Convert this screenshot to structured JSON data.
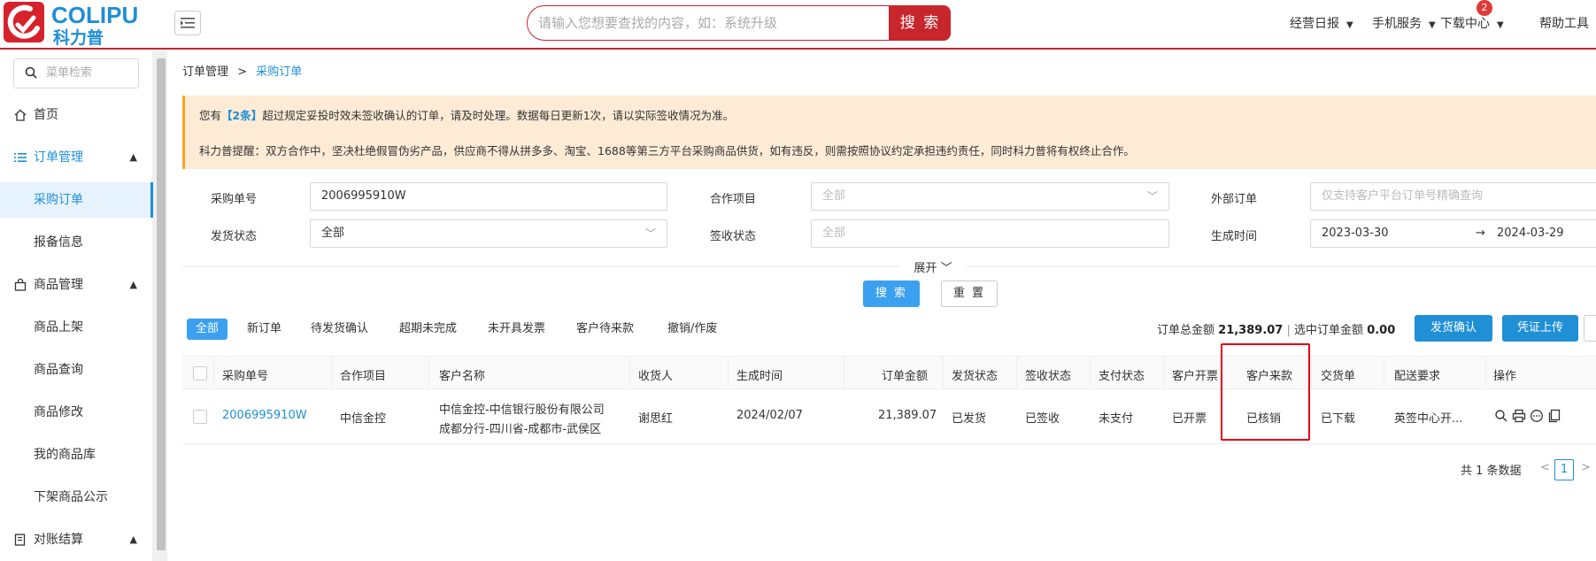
{
  "header": {
    "logo_en": "COLIPU",
    "logo_cn": "科力普",
    "search_placeholder": "请输入您想要查找的内容，如：系统升级",
    "search_button": "搜 索",
    "nav": [
      {
        "label": "经营日报"
      },
      {
        "label": "手机服务"
      },
      {
        "label": "下载中心"
      },
      {
        "label": "帮助工具"
      }
    ],
    "download_badge": "2"
  },
  "sidebar": {
    "search_placeholder": "菜单检索",
    "home": "首页",
    "order_mgmt": "订单管理",
    "purchase_order": "采购订单",
    "report_info": "报备信息",
    "product_mgmt": "商品管理",
    "product_list": "商品上架",
    "product_query": "商品查询",
    "product_edit": "商品修改",
    "my_products": "我的商品库",
    "delist_notice": "下架商品公示",
    "reconcile": "对账结算"
  },
  "breadcrumb": {
    "parent": "订单管理",
    "sep": ">",
    "current": "采购订单"
  },
  "notice": {
    "l1_pre": "您有",
    "l1_hl": "【2条】",
    "l1_post": "超过规定妥投时效未签收确认的订单，请及时处理。数据每日更新1次，请以实际签收情况为准。",
    "l2": "科力普提醒：双方合作中，坚决杜绝假冒伪劣产品，供应商不得从拼多多、淘宝、1688等第三方平台采购商品供货，如有违反，则需按照协议约定承担违约责任，同时科力普将有权终止合作。"
  },
  "filters": {
    "po_label": "采购单号",
    "po_value": "2006995910W",
    "project_label": "合作项目",
    "project_value": "全部",
    "external_label": "外部订单",
    "external_placeholder": "仅支持客户平台订单号精确查询",
    "ship_label": "发货状态",
    "ship_value": "全部",
    "sign_label": "签收状态",
    "sign_value": "全部",
    "time_label": "生成时间",
    "time_from": "2023-03-30",
    "time_arrow": "→",
    "time_to": "2024-03-29",
    "expand": "展开",
    "search": "搜 索",
    "reset": "重 置"
  },
  "tabs": [
    "全部",
    "新订单",
    "待发货确认",
    "超期未完成",
    "未开具发票",
    "客户待来款",
    "撤销/作废"
  ],
  "summary": {
    "total_label": "订单总金额",
    "total_value": "21,389.07",
    "sep": "|",
    "selected_label": "选中订单金额",
    "selected_value": "0.00"
  },
  "actions": {
    "ship_confirm": "发货确认",
    "voucher_upload": "凭证上传"
  },
  "table": {
    "headers": [
      "采购单号",
      "合作项目",
      "客户名称",
      "收货人",
      "生成时间",
      "订单金额",
      "发货状态",
      "签收状态",
      "支付状态",
      "客户开票",
      "客户来款",
      "交货单",
      "配送要求",
      "操作"
    ],
    "row": {
      "po": "2006995910W",
      "project": "中信金控",
      "customer_l1": "中信金控-中信银行股份有限公司",
      "customer_l2": "成都分行-四川省-成都市-武侯区",
      "receiver": "谢思红",
      "created": "2024/02/07",
      "amount": "21,389.07",
      "ship": "已发货",
      "sign": "已签收",
      "pay": "未支付",
      "invoice": "已开票",
      "payment": "已核销",
      "delivery": "已下载",
      "requirement": "英签中心开..."
    }
  },
  "pagination": {
    "total": "共 1 条数据",
    "page": "1"
  },
  "colors": {
    "brand_red": "#c8262d",
    "brand_blue": "#1f8fd6",
    "highlight_box": "#e60012"
  }
}
